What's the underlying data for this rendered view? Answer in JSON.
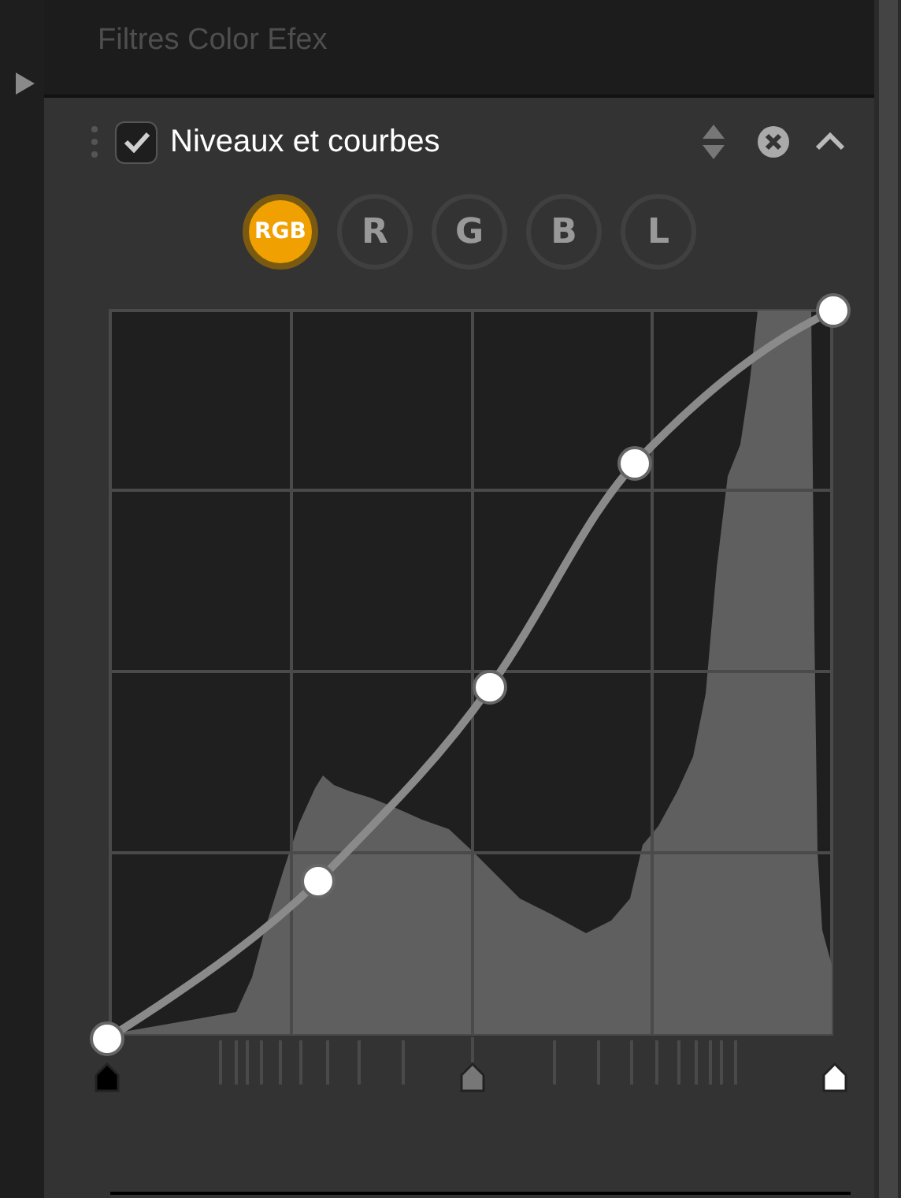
{
  "section_title": "Filtres Color Efex",
  "filter": {
    "title": "Niveaux et courbes",
    "enabled": true
  },
  "channels": [
    {
      "label": "RGB",
      "selected": true
    },
    {
      "label": "R",
      "selected": false
    },
    {
      "label": "G",
      "selected": false
    },
    {
      "label": "B",
      "selected": false
    },
    {
      "label": "L",
      "selected": false
    }
  ],
  "input_sliders": [
    {
      "kind": "black"
    },
    {
      "kind": "gamma"
    },
    {
      "kind": "white"
    }
  ]
}
